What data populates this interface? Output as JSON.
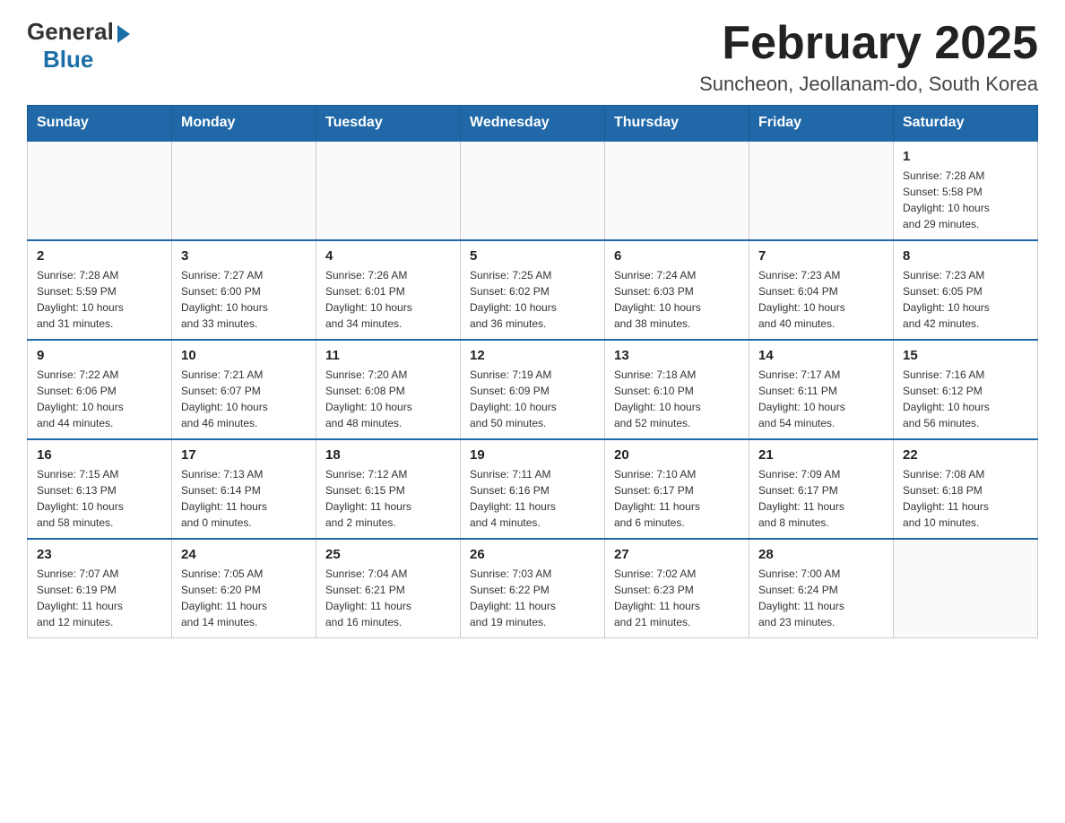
{
  "logo": {
    "general": "General",
    "blue": "Blue"
  },
  "title": "February 2025",
  "subtitle": "Suncheon, Jeollanam-do, South Korea",
  "days": [
    "Sunday",
    "Monday",
    "Tuesday",
    "Wednesday",
    "Thursday",
    "Friday",
    "Saturday"
  ],
  "weeks": [
    [
      {
        "num": "",
        "info": ""
      },
      {
        "num": "",
        "info": ""
      },
      {
        "num": "",
        "info": ""
      },
      {
        "num": "",
        "info": ""
      },
      {
        "num": "",
        "info": ""
      },
      {
        "num": "",
        "info": ""
      },
      {
        "num": "1",
        "info": "Sunrise: 7:28 AM\nSunset: 5:58 PM\nDaylight: 10 hours\nand 29 minutes."
      }
    ],
    [
      {
        "num": "2",
        "info": "Sunrise: 7:28 AM\nSunset: 5:59 PM\nDaylight: 10 hours\nand 31 minutes."
      },
      {
        "num": "3",
        "info": "Sunrise: 7:27 AM\nSunset: 6:00 PM\nDaylight: 10 hours\nand 33 minutes."
      },
      {
        "num": "4",
        "info": "Sunrise: 7:26 AM\nSunset: 6:01 PM\nDaylight: 10 hours\nand 34 minutes."
      },
      {
        "num": "5",
        "info": "Sunrise: 7:25 AM\nSunset: 6:02 PM\nDaylight: 10 hours\nand 36 minutes."
      },
      {
        "num": "6",
        "info": "Sunrise: 7:24 AM\nSunset: 6:03 PM\nDaylight: 10 hours\nand 38 minutes."
      },
      {
        "num": "7",
        "info": "Sunrise: 7:23 AM\nSunset: 6:04 PM\nDaylight: 10 hours\nand 40 minutes."
      },
      {
        "num": "8",
        "info": "Sunrise: 7:23 AM\nSunset: 6:05 PM\nDaylight: 10 hours\nand 42 minutes."
      }
    ],
    [
      {
        "num": "9",
        "info": "Sunrise: 7:22 AM\nSunset: 6:06 PM\nDaylight: 10 hours\nand 44 minutes."
      },
      {
        "num": "10",
        "info": "Sunrise: 7:21 AM\nSunset: 6:07 PM\nDaylight: 10 hours\nand 46 minutes."
      },
      {
        "num": "11",
        "info": "Sunrise: 7:20 AM\nSunset: 6:08 PM\nDaylight: 10 hours\nand 48 minutes."
      },
      {
        "num": "12",
        "info": "Sunrise: 7:19 AM\nSunset: 6:09 PM\nDaylight: 10 hours\nand 50 minutes."
      },
      {
        "num": "13",
        "info": "Sunrise: 7:18 AM\nSunset: 6:10 PM\nDaylight: 10 hours\nand 52 minutes."
      },
      {
        "num": "14",
        "info": "Sunrise: 7:17 AM\nSunset: 6:11 PM\nDaylight: 10 hours\nand 54 minutes."
      },
      {
        "num": "15",
        "info": "Sunrise: 7:16 AM\nSunset: 6:12 PM\nDaylight: 10 hours\nand 56 minutes."
      }
    ],
    [
      {
        "num": "16",
        "info": "Sunrise: 7:15 AM\nSunset: 6:13 PM\nDaylight: 10 hours\nand 58 minutes."
      },
      {
        "num": "17",
        "info": "Sunrise: 7:13 AM\nSunset: 6:14 PM\nDaylight: 11 hours\nand 0 minutes."
      },
      {
        "num": "18",
        "info": "Sunrise: 7:12 AM\nSunset: 6:15 PM\nDaylight: 11 hours\nand 2 minutes."
      },
      {
        "num": "19",
        "info": "Sunrise: 7:11 AM\nSunset: 6:16 PM\nDaylight: 11 hours\nand 4 minutes."
      },
      {
        "num": "20",
        "info": "Sunrise: 7:10 AM\nSunset: 6:17 PM\nDaylight: 11 hours\nand 6 minutes."
      },
      {
        "num": "21",
        "info": "Sunrise: 7:09 AM\nSunset: 6:17 PM\nDaylight: 11 hours\nand 8 minutes."
      },
      {
        "num": "22",
        "info": "Sunrise: 7:08 AM\nSunset: 6:18 PM\nDaylight: 11 hours\nand 10 minutes."
      }
    ],
    [
      {
        "num": "23",
        "info": "Sunrise: 7:07 AM\nSunset: 6:19 PM\nDaylight: 11 hours\nand 12 minutes."
      },
      {
        "num": "24",
        "info": "Sunrise: 7:05 AM\nSunset: 6:20 PM\nDaylight: 11 hours\nand 14 minutes."
      },
      {
        "num": "25",
        "info": "Sunrise: 7:04 AM\nSunset: 6:21 PM\nDaylight: 11 hours\nand 16 minutes."
      },
      {
        "num": "26",
        "info": "Sunrise: 7:03 AM\nSunset: 6:22 PM\nDaylight: 11 hours\nand 19 minutes."
      },
      {
        "num": "27",
        "info": "Sunrise: 7:02 AM\nSunset: 6:23 PM\nDaylight: 11 hours\nand 21 minutes."
      },
      {
        "num": "28",
        "info": "Sunrise: 7:00 AM\nSunset: 6:24 PM\nDaylight: 11 hours\nand 23 minutes."
      },
      {
        "num": "",
        "info": ""
      }
    ]
  ]
}
